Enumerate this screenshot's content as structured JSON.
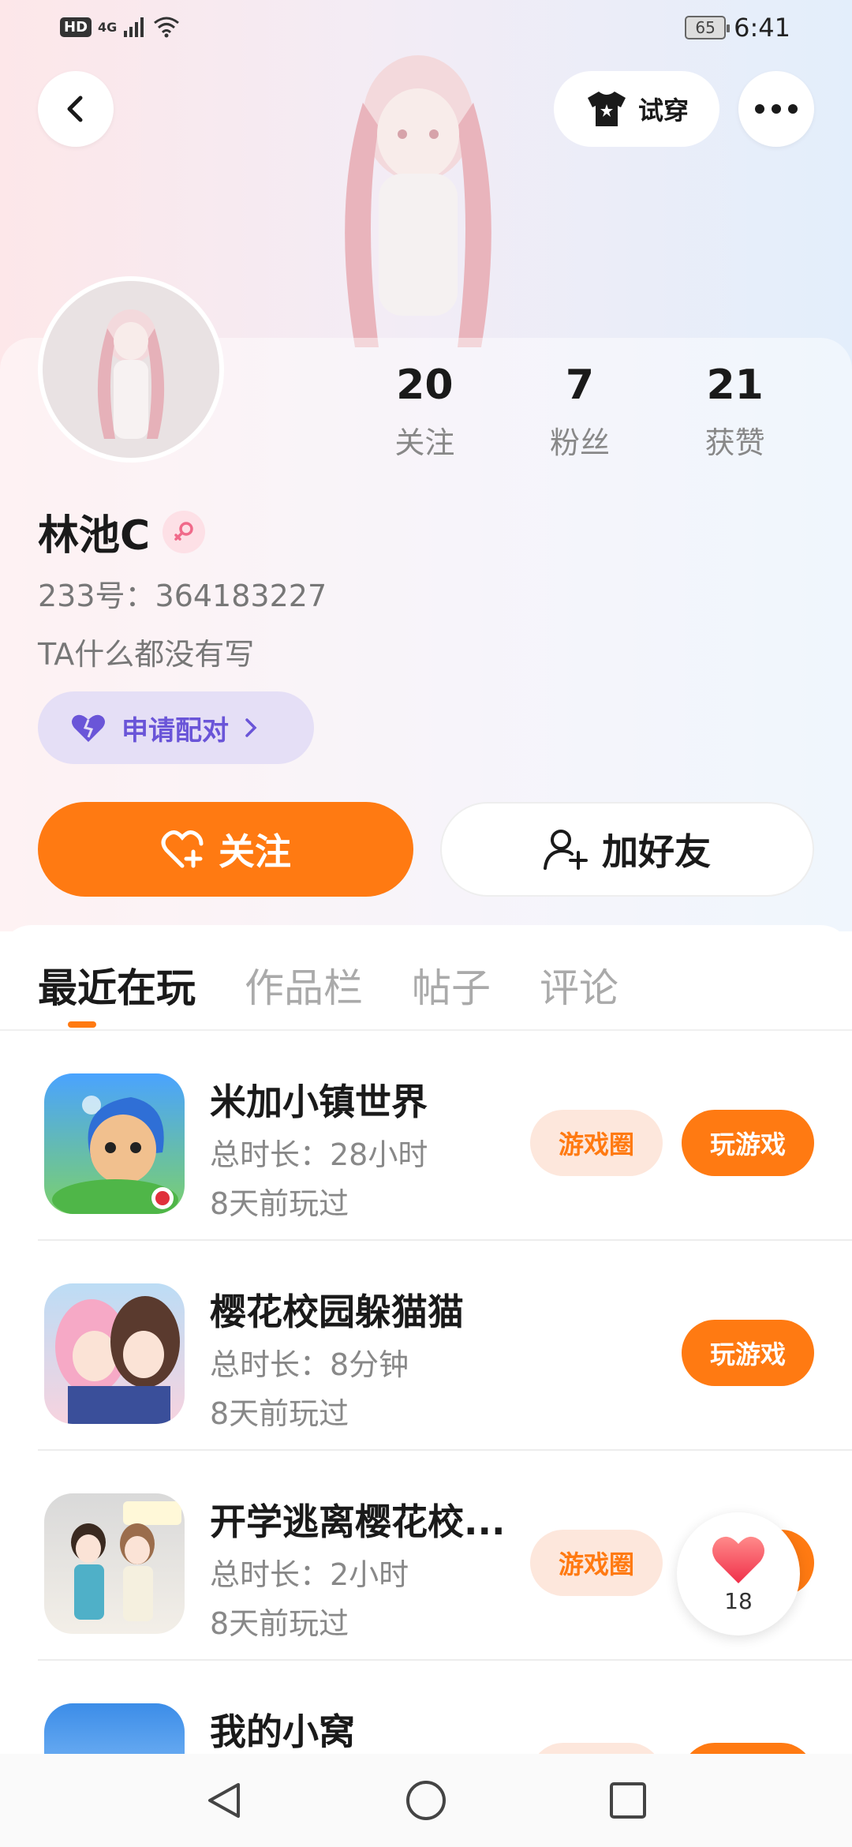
{
  "status_bar": {
    "left_badges": [
      "HD",
      "4G"
    ],
    "battery": "65",
    "time": "6:41"
  },
  "header": {
    "back_icon": "chevron-left-icon",
    "try_on_label": "试穿",
    "try_on_icon": "tshirt-icon",
    "more_icon": "more-horizontal-icon"
  },
  "profile": {
    "name": "林池C",
    "gender_icon": "female-icon",
    "uid": "233号：364183227",
    "bio": "TA什么都没有写",
    "pair_label": "申请配对",
    "stats": [
      {
        "value": "20",
        "label": "关注"
      },
      {
        "value": "7",
        "label": "粉丝"
      },
      {
        "value": "21",
        "label": "获赞"
      }
    ],
    "follow_label": "关注",
    "add_friend_label": "加好友"
  },
  "tabs": [
    {
      "label": "最近在玩",
      "active": true
    },
    {
      "label": "作品栏",
      "active": false
    },
    {
      "label": "帖子",
      "active": false
    },
    {
      "label": "评论",
      "active": false
    }
  ],
  "games": [
    {
      "title": "米加小镇世界",
      "duration": "总时长：28小时",
      "last_played": "8天前玩过",
      "circle_label": "游戏圈",
      "play_label": "玩游戏",
      "has_circle": true
    },
    {
      "title": "樱花校园躲猫猫",
      "duration": "总时长：8分钟",
      "last_played": "8天前玩过",
      "circle_label": "",
      "play_label": "玩游戏",
      "has_circle": false
    },
    {
      "title": "开学逃离樱花校...",
      "duration": "总时长：2小时",
      "last_played": "8天前玩过",
      "circle_label": "游戏圈",
      "play_label": "玩游戏",
      "has_circle": true
    },
    {
      "title": "我的小窝",
      "duration": "",
      "last_played": "",
      "circle_label": "",
      "play_label": "",
      "has_circle": true
    }
  ],
  "like_float": {
    "count": "18",
    "icon": "heart-icon"
  },
  "colors": {
    "accent": "#ff7a12",
    "pair_purple": "#6a55d8",
    "tag_bg": "#fde7dc"
  }
}
